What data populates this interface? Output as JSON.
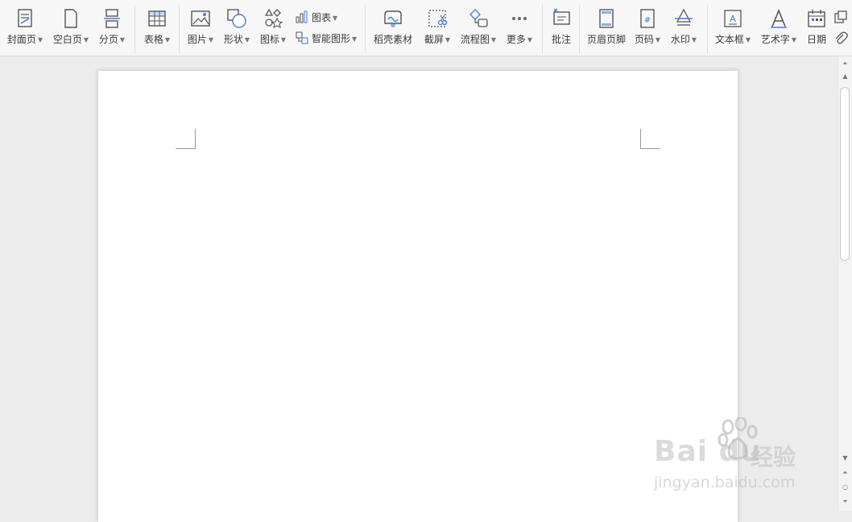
{
  "toolbar": {
    "cover_page": "封面页",
    "blank_page": "空白页",
    "page_break": "分页",
    "table": "表格",
    "picture": "图片",
    "shape": "形状",
    "icon": "图标",
    "chart": "图表",
    "smart_art": "智能图形",
    "docer_material": "稻壳素材",
    "screenshot": "截屏",
    "flowchart": "流程图",
    "more": "更多",
    "comment": "批注",
    "header_footer": "页眉页脚",
    "page_number": "页码",
    "watermark": "水印",
    "text_box": "文本框",
    "word_art": "艺术字",
    "date": "日期"
  },
  "watermark_overlay": {
    "brand": "Bai du",
    "cn": "经验",
    "url": "jingyan.baidu.com"
  },
  "colors": {
    "accent": "#4a7bd6",
    "icon_stroke": "#555555"
  }
}
